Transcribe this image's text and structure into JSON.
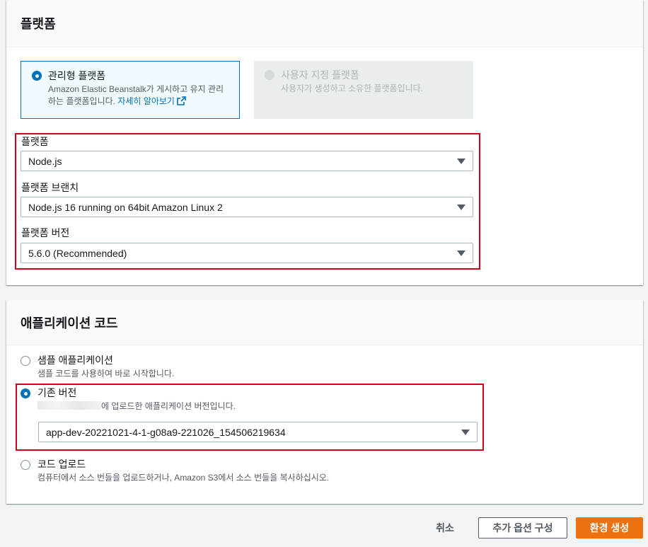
{
  "platform_panel": {
    "title": "플랫폼",
    "managed_tile": {
      "title": "관리형 플랫폼",
      "description": "Amazon Elastic Beanstalk가 게시하고 유지 관리하는 플랫폼입니다.",
      "link_text": "자세히 알아보기",
      "selected": true
    },
    "custom_tile": {
      "title": "사용자 지정 플랫폼",
      "description": "사용자가 생성하고 소유한 플랫폼입니다.",
      "disabled": true
    },
    "platform_label": "플랫폼",
    "platform_value": "Node.js",
    "branch_label": "플랫폼 브랜치",
    "branch_value": "Node.js 16 running on 64bit Amazon Linux 2",
    "version_label": "플랫폼 버전",
    "version_value": "5.6.0 (Recommended)"
  },
  "code_panel": {
    "title": "애플리케이션 코드",
    "options": [
      {
        "title": "샘플 애플리케이션",
        "description": "샘플 코드를 사용하여 바로 시작합니다.",
        "selected": false
      },
      {
        "title": "기존 버전",
        "description": "에 업로드한 애플리케이션 버전입니다.",
        "selected": true
      },
      {
        "title": "코드 업로드",
        "description": "컴퓨터에서 소스 번들을 업로드하거나, Amazon S3에서 소스 번들을 복사하십시오.",
        "selected": false
      }
    ],
    "existing_version_value": "app-dev-20221021-4-1-g08a9-221026_154506219634"
  },
  "footer": {
    "cancel_label": "취소",
    "configure_more_label": "추가 옵션 구성",
    "create_label": "환경 생성"
  },
  "colors": {
    "accent": "#0073bb",
    "primary_button": "#ec7211",
    "highlight_box": "#d0021b"
  }
}
